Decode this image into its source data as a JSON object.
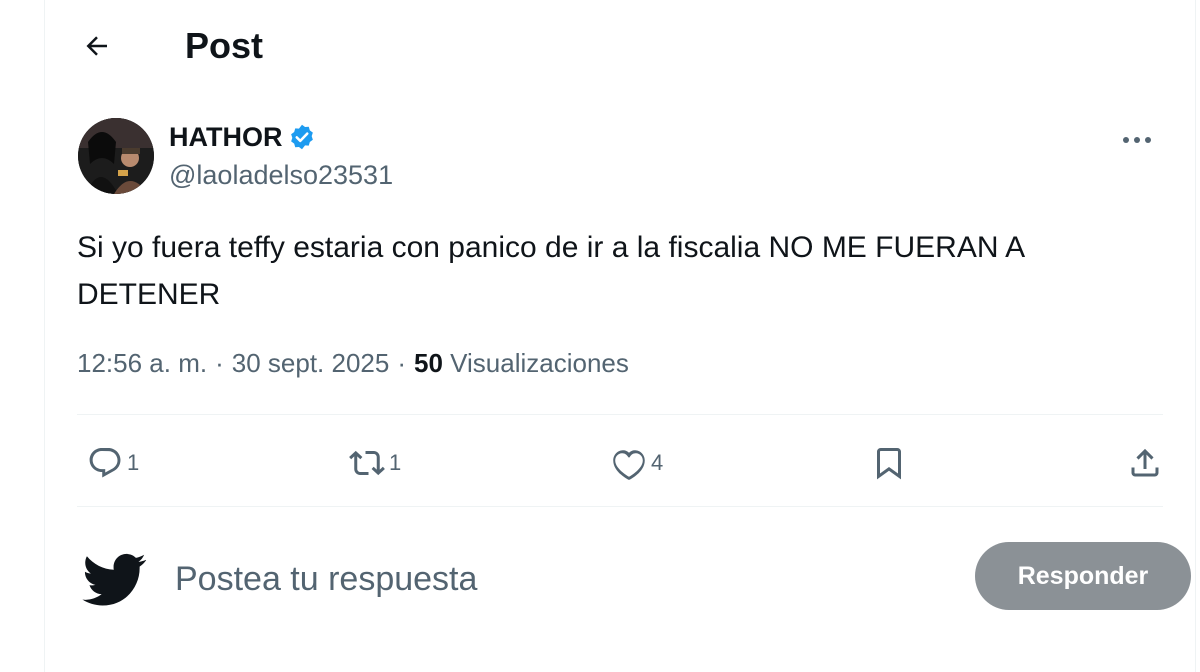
{
  "header": {
    "title": "Post"
  },
  "author": {
    "name": "HATHOR",
    "handle": "@laoladelso23531",
    "verified": true,
    "verified_color": "#1d9bf0"
  },
  "post": {
    "text": "Si yo fuera teffy estaria con panico de ir a la fiscalia NO ME FUERAN A DETENER",
    "time": "12:56 a. m.",
    "separator": "·",
    "date": "30 sept. 2025",
    "views_count": "50",
    "views_label": "Visualizaciones"
  },
  "actions": {
    "reply_count": "1",
    "repost_count": "1",
    "like_count": "4"
  },
  "reply": {
    "placeholder": "Postea tu respuesta",
    "button_label": "Responder",
    "button_color": "#8b9196"
  },
  "icons": {
    "back": "arrow-left-icon",
    "more": "more-horizontal-icon",
    "verified": "verified-badge-icon",
    "reply": "comment-icon",
    "repost": "repost-icon",
    "like": "heart-icon",
    "bookmark": "bookmark-icon",
    "share": "share-icon",
    "brand": "twitter-bird-icon"
  }
}
